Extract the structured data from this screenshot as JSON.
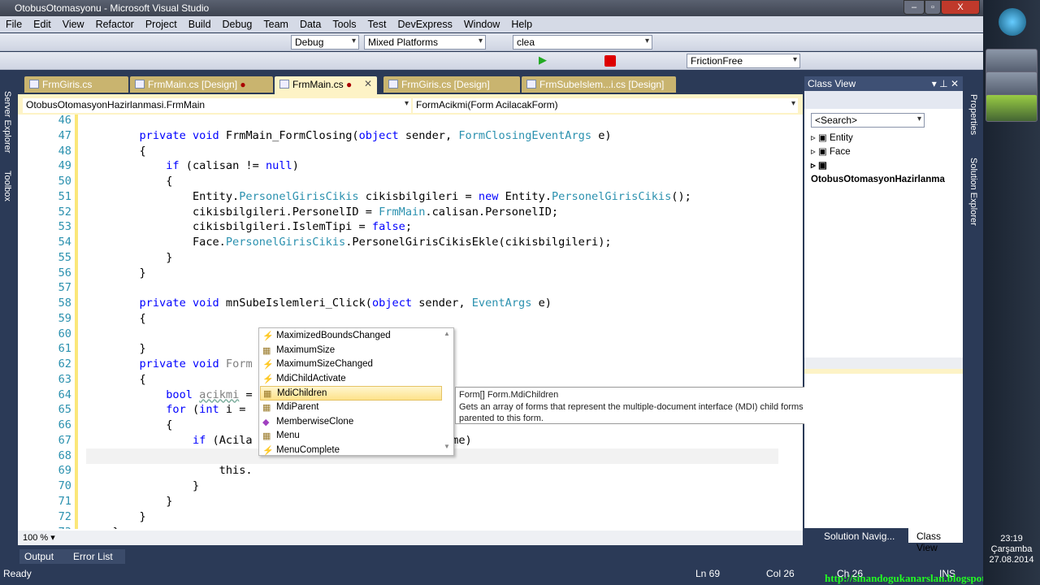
{
  "window": {
    "title": "OtobusOtomasyonu - Microsoft Visual Studio",
    "min": "–",
    "max": "▫",
    "close": "X"
  },
  "menu": [
    "File",
    "Edit",
    "View",
    "Refactor",
    "Project",
    "Build",
    "Debug",
    "Team",
    "Data",
    "Tools",
    "Test",
    "DevExpress",
    "Window",
    "Help"
  ],
  "toolbar": {
    "config": "Debug",
    "platform": "Mixed Platforms",
    "find": "clea",
    "theme": "FrictionFree"
  },
  "left_strip": [
    "Server Explorer",
    "Toolbox"
  ],
  "right_strip": [
    "Properties",
    "Solution Explorer"
  ],
  "tabs": [
    {
      "label": "FrmGiris.cs",
      "dirty": ""
    },
    {
      "label": "FrmMain.cs [Design]",
      "dirty": "●"
    },
    {
      "label": "FrmMain.cs",
      "dirty": "●"
    },
    {
      "label": "FrmGiris.cs [Design]",
      "dirty": ""
    },
    {
      "label": "FrmSubeIslem...i.cs [Design]",
      "dirty": ""
    }
  ],
  "navbar": {
    "type": "OtobusOtomasyonHazirlanmasi.FrmMain",
    "member": "FormAcikmi(Form AcilacakForm)"
  },
  "code": [
    {
      "n": "46",
      "t": []
    },
    {
      "n": "47",
      "t": [
        [
          "        ",
          "p"
        ],
        [
          "private void",
          "k"
        ],
        [
          " FrmMain_FormClosing(",
          "p"
        ],
        [
          "object",
          "k"
        ],
        [
          " sender, ",
          "p"
        ],
        [
          "FormClosingEventArgs",
          "t"
        ],
        [
          " e)",
          "p"
        ]
      ]
    },
    {
      "n": "48",
      "t": [
        [
          "        {",
          "p"
        ]
      ]
    },
    {
      "n": "49",
      "t": [
        [
          "            ",
          "p"
        ],
        [
          "if",
          "k"
        ],
        [
          " (calisan != ",
          "p"
        ],
        [
          "null",
          "k"
        ],
        [
          ")",
          "p"
        ]
      ]
    },
    {
      "n": "50",
      "t": [
        [
          "            {",
          "p"
        ]
      ]
    },
    {
      "n": "51",
      "t": [
        [
          "                Entity.",
          "p"
        ],
        [
          "PersonelGirisCikis",
          "t"
        ],
        [
          " cikisbilgileri = ",
          "p"
        ],
        [
          "new",
          "k"
        ],
        [
          " Entity.",
          "p"
        ],
        [
          "PersonelGirisCikis",
          "t"
        ],
        [
          "();",
          "p"
        ]
      ]
    },
    {
      "n": "52",
      "t": [
        [
          "                cikisbilgileri.PersonelID = ",
          "p"
        ],
        [
          "FrmMain",
          "t"
        ],
        [
          ".calisan.PersonelID;",
          "p"
        ]
      ]
    },
    {
      "n": "53",
      "t": [
        [
          "                cikisbilgileri.IslemTipi = ",
          "p"
        ],
        [
          "false",
          "k"
        ],
        [
          ";",
          "p"
        ]
      ]
    },
    {
      "n": "54",
      "t": [
        [
          "                Face.",
          "p"
        ],
        [
          "PersonelGirisCikis",
          "t"
        ],
        [
          ".PersonelGirisCikisEkle(cikisbilgileri);",
          "p"
        ]
      ]
    },
    {
      "n": "55",
      "t": [
        [
          "            }",
          "p"
        ]
      ]
    },
    {
      "n": "56",
      "t": [
        [
          "        }",
          "p"
        ]
      ]
    },
    {
      "n": "57",
      "t": []
    },
    {
      "n": "58",
      "t": [
        [
          "        ",
          "p"
        ],
        [
          "private void",
          "k"
        ],
        [
          " mnSubeIslemleri_Click(",
          "p"
        ],
        [
          "object",
          "k"
        ],
        [
          " sender, ",
          "p"
        ],
        [
          "EventArgs",
          "t"
        ],
        [
          " e)",
          "p"
        ]
      ]
    },
    {
      "n": "59",
      "t": [
        [
          "        {",
          "p"
        ]
      ]
    },
    {
      "n": "60",
      "t": []
    },
    {
      "n": "61",
      "t": [
        [
          "        }",
          "p"
        ]
      ]
    },
    {
      "n": "62",
      "t": [
        [
          "        ",
          "p"
        ],
        [
          "private void",
          "k"
        ],
        [
          " Form",
          "u2"
        ]
      ]
    },
    {
      "n": "63",
      "t": [
        [
          "        {",
          "p"
        ]
      ]
    },
    {
      "n": "64",
      "t": [
        [
          "            ",
          "p"
        ],
        [
          "bool",
          "k"
        ],
        [
          " ",
          "p"
        ],
        [
          "acikmi",
          "u"
        ],
        [
          " =",
          "p"
        ]
      ]
    },
    {
      "n": "65",
      "t": [
        [
          "            ",
          "p"
        ],
        [
          "for",
          "k"
        ],
        [
          " (",
          "p"
        ],
        [
          "int",
          "k"
        ],
        [
          " i =",
          "p"
        ]
      ]
    },
    {
      "n": "66",
      "t": [
        [
          "            {",
          "p"
        ]
      ]
    },
    {
      "n": "67",
      "t": [
        [
          "                ",
          "p"
        ],
        [
          "if",
          "k"
        ],
        [
          " (Acila                          ].Name)",
          "p"
        ]
      ]
    },
    {
      "n": "68",
      "t": [
        [
          "                {",
          "p"
        ]
      ]
    },
    {
      "n": "69",
      "t": [
        [
          "                    this.",
          "p"
        ]
      ]
    },
    {
      "n": "70",
      "t": [
        [
          "                }",
          "p"
        ]
      ]
    },
    {
      "n": "71",
      "t": [
        [
          "            }",
          "p"
        ]
      ]
    },
    {
      "n": "72",
      "t": [
        [
          "        }",
          "p"
        ]
      ]
    },
    {
      "n": "73",
      "t": [
        [
          "    }",
          "p"
        ]
      ]
    }
  ],
  "zoom": "100 %",
  "completion": [
    {
      "label": "MaximizedBoundsChanged",
      "icon": "event"
    },
    {
      "label": "MaximumSize",
      "icon": "property"
    },
    {
      "label": "MaximumSizeChanged",
      "icon": "event"
    },
    {
      "label": "MdiChildActivate",
      "icon": "event"
    },
    {
      "label": "MdiChildren",
      "icon": "property",
      "selected": true
    },
    {
      "label": "MdiParent",
      "icon": "property"
    },
    {
      "label": "MemberwiseClone",
      "icon": "method"
    },
    {
      "label": "Menu",
      "icon": "property"
    },
    {
      "label": "MenuComplete",
      "icon": "event"
    }
  ],
  "tooltip": {
    "signature": "Form[] Form.MdiChildren",
    "desc1": "Gets an array of forms that represent the multiple-document interface (MDI) child forms that are",
    "desc2": "parented to this form."
  },
  "classview": {
    "title": "Class View",
    "search": "<Search>",
    "tree": [
      "Entity",
      "Face",
      "OtobusOtomasyonHazirlanma"
    ],
    "bottom_tabs": [
      "Solution Navig...",
      "Class View"
    ]
  },
  "bottom_tabs": [
    "Output",
    "Error List"
  ],
  "status": {
    "ready": "Ready",
    "ln": "Ln 69",
    "col": "Col 26",
    "ch": "Ch 26",
    "ins": "INS",
    "watermark": "http://sinandogukanarslan.blogspot.com.tr/"
  },
  "clock": {
    "time": "23:19",
    "day": "Çarşamba",
    "date": "27.08.2014"
  }
}
